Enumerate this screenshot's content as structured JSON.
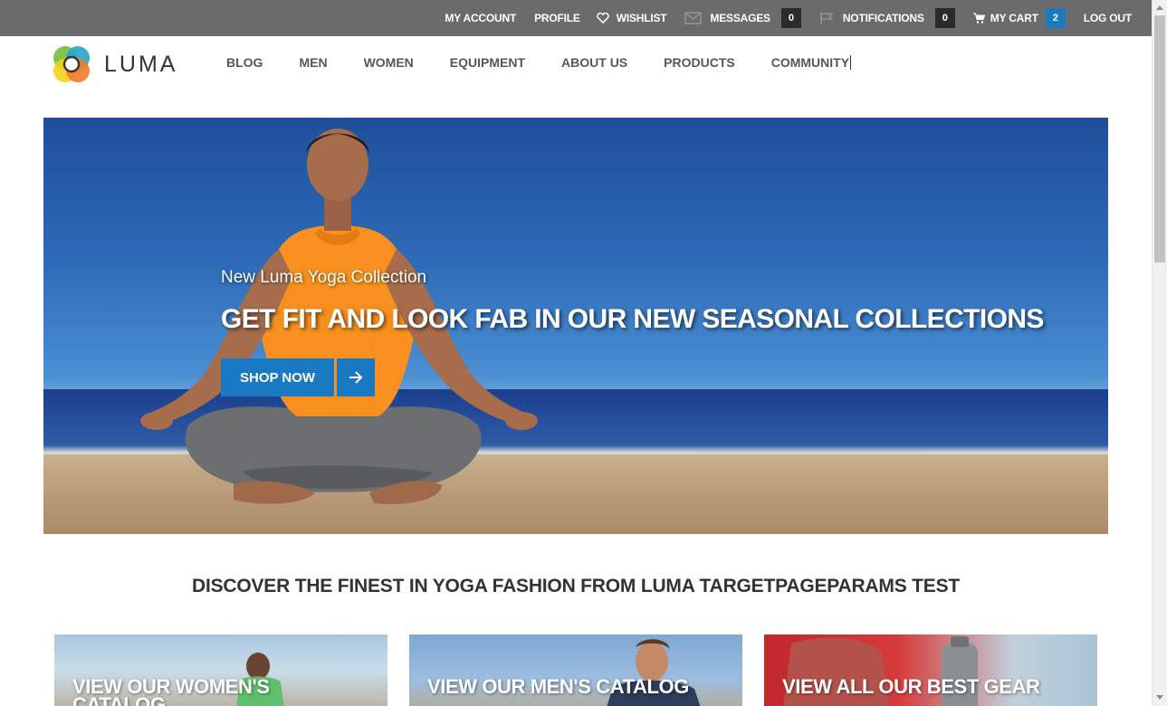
{
  "topbar": {
    "my_account": "MY ACCOUNT",
    "profile": "PROFILE",
    "wishlist": "WISHLIST",
    "messages": "MESSAGES",
    "messages_count": "0",
    "notifications": "NOTIFICATIONS",
    "notifications_count": "0",
    "my_cart": "MY CART",
    "cart_count": "2",
    "log_out": "LOG OUT",
    "icons": [
      "heart-icon",
      "envelope-icon",
      "flag-icon",
      "cart-icon"
    ]
  },
  "header": {
    "logo_text": "LUMA",
    "nav": [
      "BLOG",
      "MEN",
      "WOMEN",
      "EQUIPMENT",
      "ABOUT US",
      "PRODUCTS",
      "COMMUNITY"
    ]
  },
  "hero": {
    "subtitle": "New Luma Yoga Collection",
    "title": "GET FIT AND LOOK FAB IN OUR NEW SEASONAL COLLECTIONS",
    "button_label": "SHOP NOW",
    "button_icon": "arrow-right-icon"
  },
  "section": {
    "heading": "DISCOVER THE FINEST IN YOGA FASHION FROM LUMA TARGETPAGEPARAMS TEST"
  },
  "tiles": [
    {
      "label": "VIEW OUR WOMEN'S CATALOG"
    },
    {
      "label": "VIEW OUR MEN'S CATALOG"
    },
    {
      "label": "VIEW ALL OUR BEST GEAR"
    }
  ],
  "colors": {
    "accent": "#1979c3",
    "topbar": "#6b6b6b",
    "text": "#333333"
  }
}
